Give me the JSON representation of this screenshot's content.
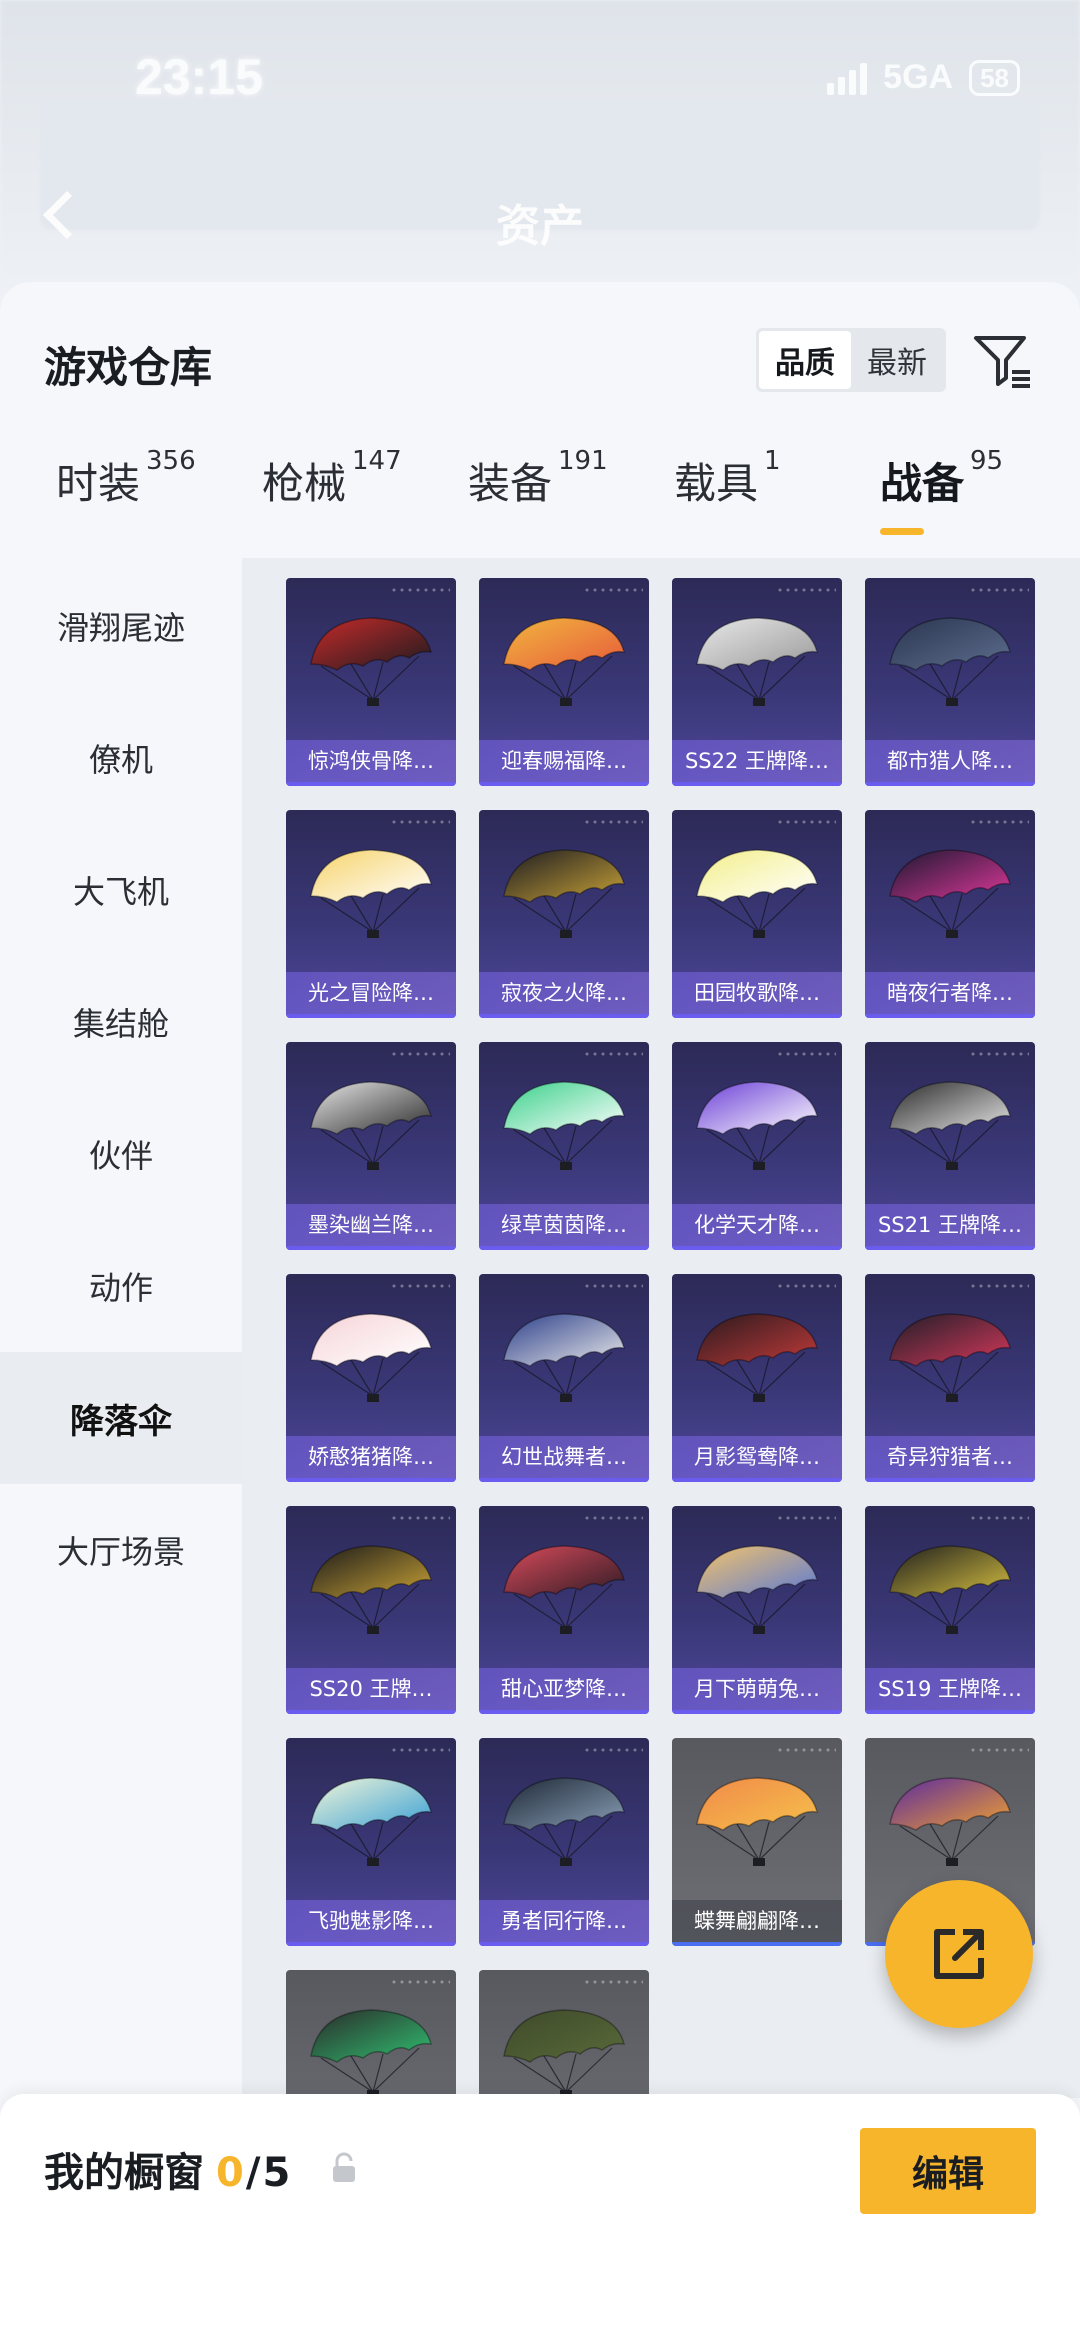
{
  "status_bar": {
    "time": "23:15",
    "network": "5GA",
    "battery": "58"
  },
  "background_page": {
    "title": "资产"
  },
  "sheet": {
    "title": "游戏仓库",
    "sort_options": [
      "品质",
      "最新"
    ],
    "active_sort": "品质"
  },
  "tabs": [
    {
      "label": "时装",
      "count": "356"
    },
    {
      "label": "枪械",
      "count": "147"
    },
    {
      "label": "装备",
      "count": "191"
    },
    {
      "label": "载具",
      "count": "1"
    },
    {
      "label": "战备",
      "count": "95"
    }
  ],
  "active_tab": "战备",
  "sidenav": [
    {
      "label": "滑翔尾迹"
    },
    {
      "label": "僚机"
    },
    {
      "label": "大飞机"
    },
    {
      "label": "集结舱"
    },
    {
      "label": "伙伴"
    },
    {
      "label": "动作"
    },
    {
      "label": "降落伞"
    },
    {
      "label": "大厅场景"
    }
  ],
  "active_side": "降落伞",
  "items": [
    {
      "name": "惊鸿侠骨降…",
      "rarity": "purple",
      "colors": [
        "#c72a2a",
        "#1b1b1f"
      ]
    },
    {
      "name": "迎春赐福降…",
      "rarity": "purple",
      "colors": [
        "#f2b640",
        "#e65a3a"
      ]
    },
    {
      "name": "SS22 王牌降…",
      "rarity": "purple",
      "colors": [
        "#e8e8e8",
        "#9a9a9a"
      ]
    },
    {
      "name": "都市猎人降…",
      "rarity": "purple",
      "colors": [
        "#2a3550",
        "#5e6e8e"
      ]
    },
    {
      "name": "光之冒险降…",
      "rarity": "purple",
      "colors": [
        "#f6d36a",
        "#ffffff"
      ]
    },
    {
      "name": "寂夜之火降…",
      "rarity": "purple",
      "colors": [
        "#1c1c22",
        "#c9a236"
      ]
    },
    {
      "name": "田园牧歌降…",
      "rarity": "purple",
      "colors": [
        "#f3ef8a",
        "#ffffff"
      ]
    },
    {
      "name": "暗夜行者降…",
      "rarity": "purple",
      "colors": [
        "#1a1830",
        "#e0389a"
      ]
    },
    {
      "name": "墨染幽兰降…",
      "rarity": "purple",
      "colors": [
        "#e6e6e6",
        "#2b2b2b"
      ]
    },
    {
      "name": "绿草茵茵降…",
      "rarity": "purple",
      "colors": [
        "#3ad08a",
        "#ffffff"
      ]
    },
    {
      "name": "化学天才降…",
      "rarity": "purple",
      "colors": [
        "#6b3fd6",
        "#ffffff"
      ]
    },
    {
      "name": "SS21 王牌降…",
      "rarity": "purple",
      "colors": [
        "#2b2b2b",
        "#e8e8e8"
      ]
    },
    {
      "name": "娇憨猪猪降…",
      "rarity": "purple",
      "colors": [
        "#f6d4d8",
        "#ffffff"
      ]
    },
    {
      "name": "幻世战舞者…",
      "rarity": "purple",
      "colors": [
        "#2c3f8a",
        "#eaeaea"
      ]
    },
    {
      "name": "月影鸳鸯降…",
      "rarity": "purple",
      "colors": [
        "#2a1a1e",
        "#c23a3a"
      ]
    },
    {
      "name": "奇异狩猎者…",
      "rarity": "purple",
      "colors": [
        "#1e1e28",
        "#d6385a"
      ]
    },
    {
      "name": "SS20 王牌…",
      "rarity": "purple",
      "colors": [
        "#1a1a1a",
        "#c9a236"
      ]
    },
    {
      "name": "甜心亚梦降…",
      "rarity": "purple",
      "colors": [
        "#d84a5a",
        "#2b1b24"
      ]
    },
    {
      "name": "月下萌萌兔…",
      "rarity": "purple",
      "colors": [
        "#f4c36a",
        "#5a7ad6"
      ]
    },
    {
      "name": "SS19 王牌降…",
      "rarity": "purple",
      "colors": [
        "#1e1e1e",
        "#d6c040"
      ]
    },
    {
      "name": "飞驰魅影降…",
      "rarity": "purple",
      "colors": [
        "#f1f5d8",
        "#3aa0d6"
      ]
    },
    {
      "name": "勇者同行降…",
      "rarity": "purple",
      "colors": [
        "#1e2836",
        "#8aa0b8"
      ]
    },
    {
      "name": "蝶舞翩翩降…",
      "rarity": "gray",
      "colors": [
        "#f08a4a",
        "#f6c04a"
      ]
    },
    {
      "name": "",
      "rarity": "gray",
      "colors": [
        "#5a2aa0",
        "#f0a030"
      ]
    },
    {
      "name": "",
      "rarity": "gray",
      "colors": [
        "#2a2a2a",
        "#30c070"
      ]
    },
    {
      "name": "",
      "rarity": "gray",
      "colors": [
        "#3e4a2a",
        "#5a6a3a"
      ]
    }
  ],
  "share_button": {
    "icon": "external-share-icon"
  },
  "bottom": {
    "showcase_label": "我的橱窗",
    "showcase_current": "0",
    "showcase_sep": "/",
    "showcase_total": "5",
    "edit_label": "编辑"
  },
  "accent_color": "#f7b52c"
}
